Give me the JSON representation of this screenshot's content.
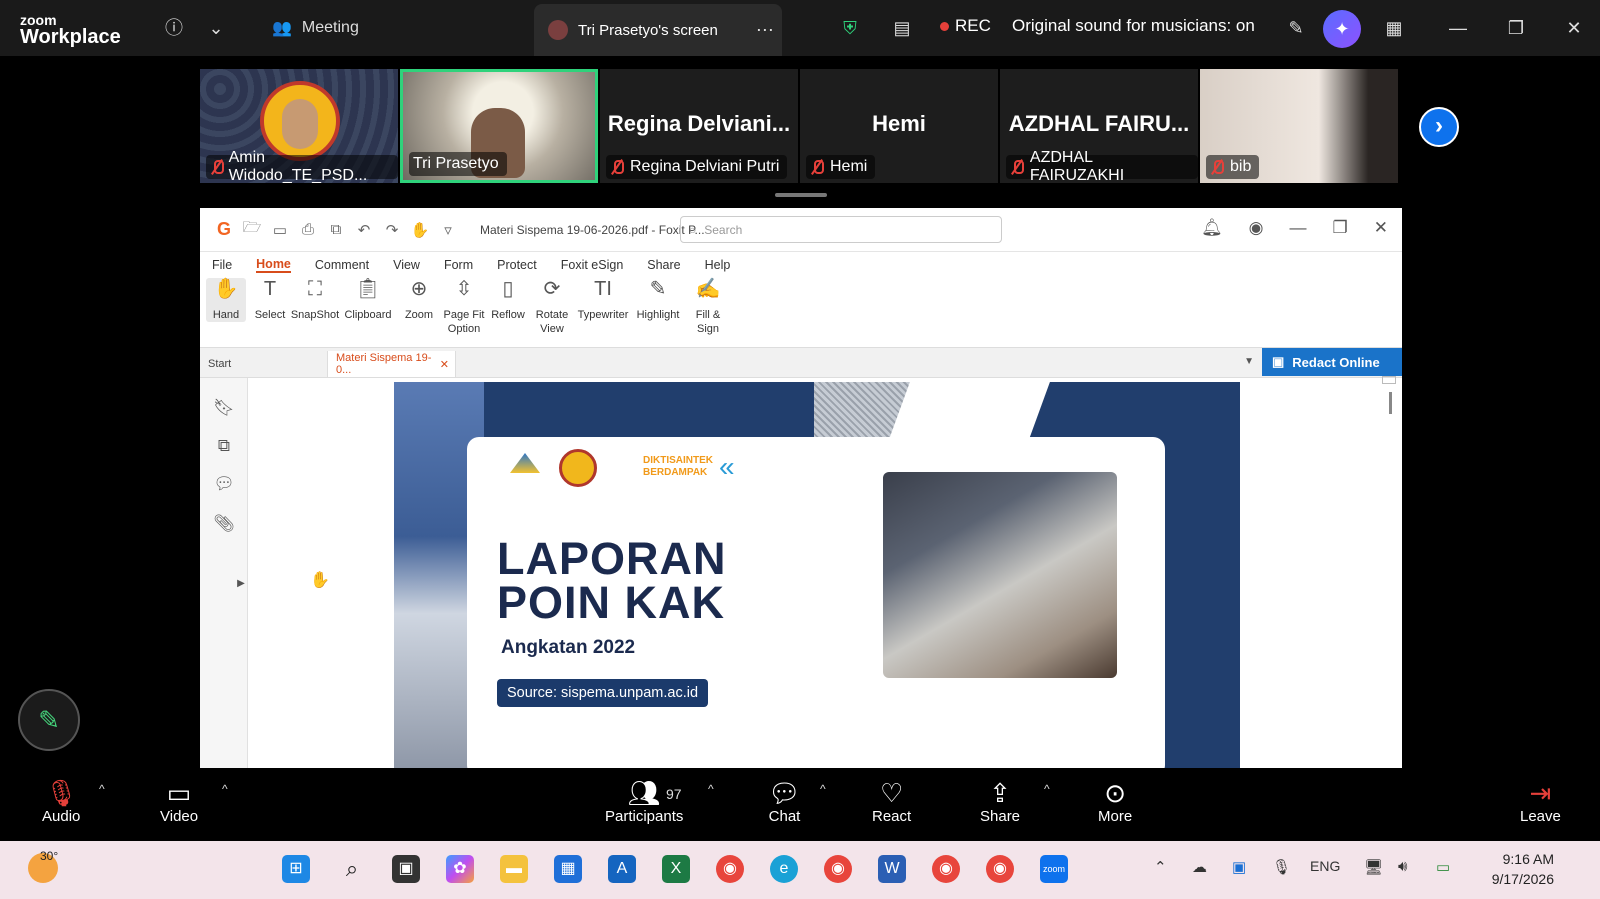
{
  "zoom": {
    "logo_top": "zoom",
    "logo_bottom": "Workplace",
    "meeting_label": "Meeting",
    "screen_tab_label": "Tri Prasetyo's screen",
    "rec_label": "REC",
    "original_sound": "Original sound for musicians: on"
  },
  "gallery": [
    {
      "name": "Amin Widodo_TE_PSD...",
      "big": ""
    },
    {
      "name": "Tri Prasetyo",
      "big": ""
    },
    {
      "name": "Regina Delviani Putri",
      "big": "Regina  Delviani..."
    },
    {
      "name": "Hemi",
      "big": "Hemi"
    },
    {
      "name": "AZDHAL FAIRUZAKHI",
      "big": "AZDHAL  FAIRU..."
    },
    {
      "name": "bib",
      "big": ""
    }
  ],
  "foxit": {
    "doc_title": "Materi Sispema 19-06-2026.pdf - Foxit P...",
    "search_placeholder": "Search",
    "menu": [
      "File",
      "Home",
      "Comment",
      "View",
      "Form",
      "Protect",
      "Foxit eSign",
      "Share",
      "Help"
    ],
    "ribbon": [
      {
        "icon": "hand-icon",
        "label": "Hand"
      },
      {
        "icon": "select-icon",
        "label": "Select"
      },
      {
        "icon": "snapshot-icon",
        "label": "SnapShot"
      },
      {
        "icon": "clipboard-icon",
        "label": "Clipboard"
      },
      {
        "icon": "zoom-icon",
        "label": "Zoom"
      },
      {
        "icon": "page-fit-icon",
        "label": "Page Fit Option"
      },
      {
        "icon": "reflow-icon",
        "label": "Reflow"
      },
      {
        "icon": "rotate-view-icon",
        "label": "Rotate View"
      },
      {
        "icon": "typewriter-icon",
        "label": "Typewriter"
      },
      {
        "icon": "highlight-icon",
        "label": "Highlight"
      },
      {
        "icon": "fill-sign-icon",
        "label": "Fill & Sign"
      }
    ],
    "tab_start": "Start",
    "tab_doc": "Materi Sispema 19-0...",
    "redact_label": "Redact Online"
  },
  "slide": {
    "title_line1": "LAPORAN",
    "title_line2": "POIN KAK",
    "subtitle": "Angkatan 2022",
    "source": "Source: sispema.unpam.ac.id",
    "logo_text": "DIKTISAINTEK BERDAMPAK"
  },
  "controls": {
    "audio": "Audio",
    "video": "Video",
    "participants": "Participants",
    "participants_count": "97",
    "chat": "Chat",
    "react": "React",
    "share": "Share",
    "more": "More",
    "leave": "Leave"
  },
  "taskbar": {
    "temperature": "30°",
    "language": "ENG",
    "time": "9:16 AM",
    "date": "9/17/2026"
  },
  "colors": {
    "zoom_blue": "#0e72ed",
    "active_speaker": "#2fd27b",
    "foxit_accent": "#d84c1b",
    "redact_blue": "#1a73c9",
    "slide_navy": "#1b2a4e"
  }
}
